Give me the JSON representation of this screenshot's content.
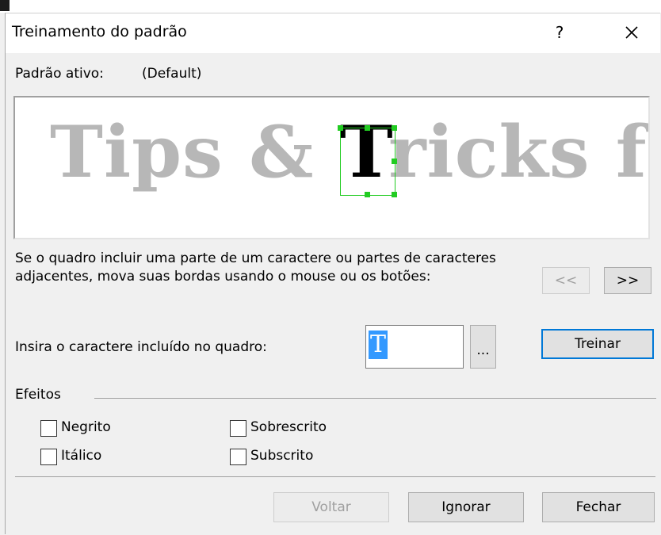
{
  "window": {
    "title": "Treinamento do padrão",
    "help_label": "?"
  },
  "active_pattern": {
    "label": "Padrão ativo:",
    "value": "(Default)"
  },
  "preview": {
    "before": "Tips & ",
    "current_char": "T",
    "after": "ricks fo"
  },
  "instructions": "Se o quadro incluir uma parte de um caractere ou partes de caracteres adjacentes, mova suas bordas usando o mouse ou os botões:",
  "nav": {
    "prev_label": "<<",
    "next_label": ">>"
  },
  "char_entry": {
    "label": "Insira o caractere incluído no quadro:",
    "value": "T",
    "browse_label": "...",
    "train_label": "Treinar"
  },
  "effects": {
    "label": "Efeitos",
    "bold": "Negrito",
    "italic": "Itálico",
    "superscript": "Sobrescrito",
    "subscript": "Subscrito"
  },
  "footer": {
    "back_label": "Voltar",
    "ignore_label": "Ignorar",
    "close_label": "Fechar"
  }
}
